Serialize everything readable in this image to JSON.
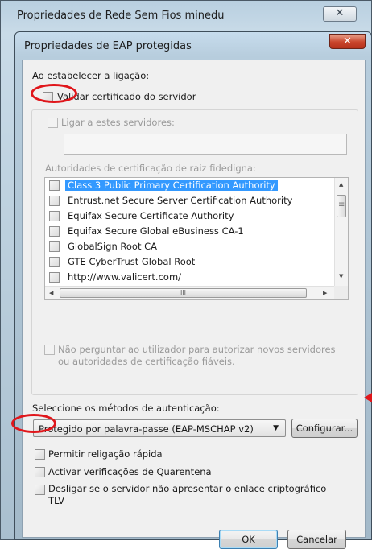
{
  "back_window": {
    "title": "Propriedades de Rede Sem Fios minedu",
    "close": "✕"
  },
  "dialog": {
    "title": "Propriedades de EAP protegidas",
    "close": "✕",
    "section_connect": "Ao estabelecer a ligação:",
    "validate_cert_label": "Validar certificado do servidor",
    "connect_servers_label": "Ligar a estes servidores:",
    "servers_value": "",
    "root_ca_label": "Autoridades de certificação de raiz fidedigna:",
    "root_cas": [
      "Class 3 Public Primary Certification Authority",
      "Entrust.net Secure Server Certification Authority",
      "Equifax Secure Certificate Authority",
      "Equifax Secure Global eBusiness CA-1",
      "GlobalSign Root CA",
      "GTE CyberTrust Global Root",
      "http://www.valicert.com/"
    ],
    "selected_ca_index": 0,
    "hscroll_thumb": "III",
    "no_prompt_label_line1": "Não perguntar ao utilizador para autorizar novos servidores",
    "no_prompt_label_line2": "ou autoridades de certificação fiáveis.",
    "auth_method_label": "Seleccione os métodos de autenticação:",
    "auth_method_value": "Protegido por palavra-passe (EAP-MSCHAP v2)",
    "configure_button": "Configurar...",
    "fast_reconnect_label": "Permitir religação rápida",
    "quarantine_label": "Activar verificações de Quarentena",
    "disconnect_label_line1": "Desligar se o servidor não apresentar o enlace criptográfico",
    "disconnect_label_line2": "TLV",
    "ok_button": "OK",
    "cancel_button": "Cancelar"
  },
  "icons": {
    "combo_arrow": "▼",
    "scroll_up": "▲",
    "scroll_down": "▼",
    "scroll_left": "◀",
    "scroll_right": "▶",
    "grip": "≡"
  },
  "colors": {
    "selection": "#3399ff",
    "annotation_red": "#e0161b"
  }
}
